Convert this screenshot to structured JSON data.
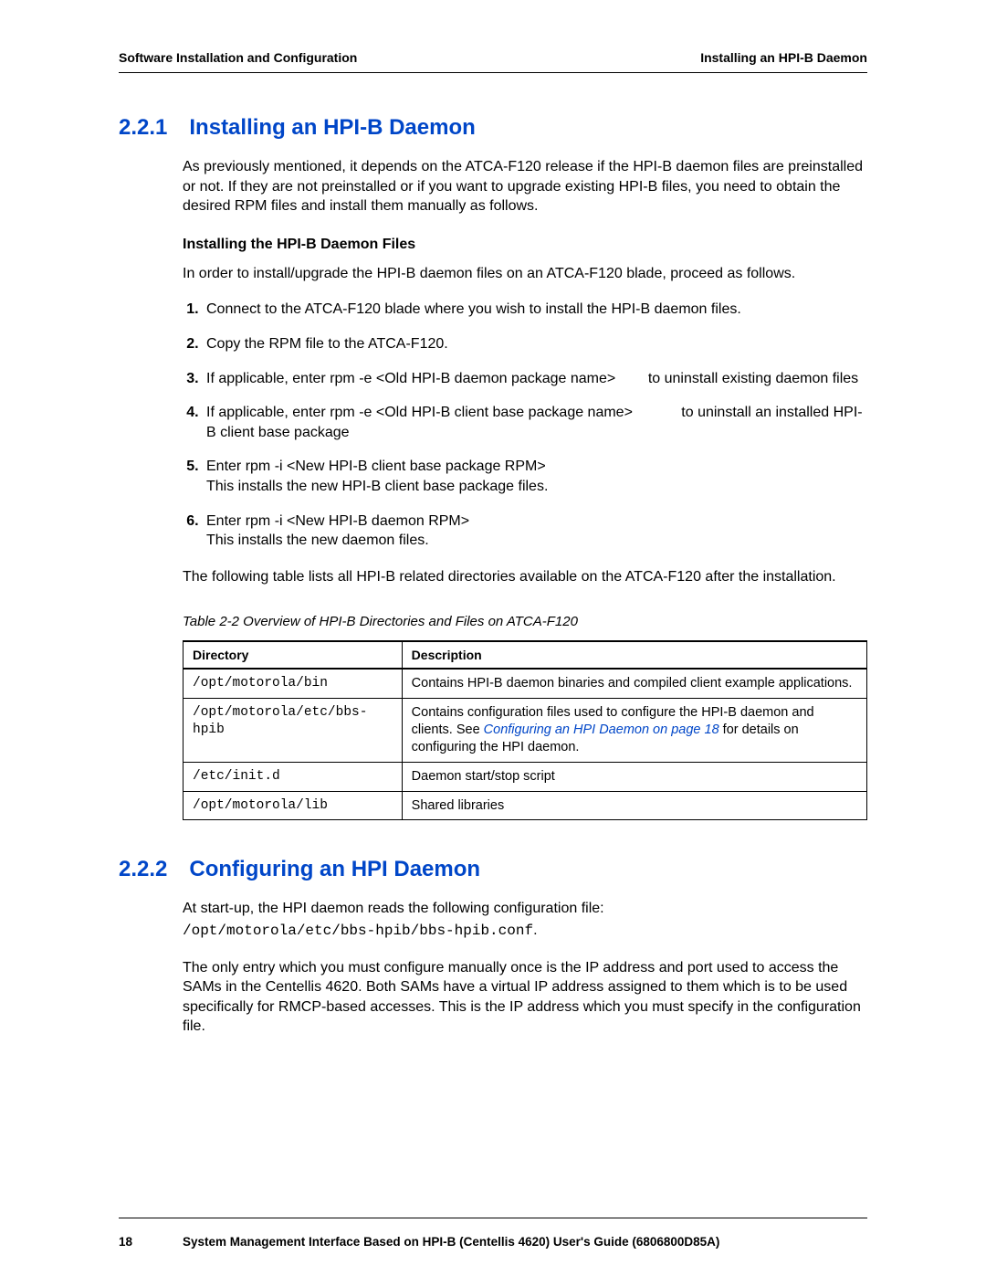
{
  "header": {
    "left": "Software Installation and Configuration",
    "right": "Installing an HPI-B Daemon"
  },
  "section221": {
    "number": "2.2.1",
    "title": "Installing an HPI-B Daemon",
    "intro": "As previously mentioned, it depends on the ATCA-F120 release if the HPI-B daemon files are preinstalled or not. If they are not preinstalled or if you want to upgrade existing HPI-B files, you need to obtain the desired RPM files and install them manually as follows.",
    "subheading": "Installing the HPI-B Daemon Files",
    "subintro": "In order to install/upgrade the HPI-B daemon files on an ATCA-F120 blade, proceed as follows.",
    "steps": {
      "s1": "Connect to the ATCA-F120 blade where you wish to install the HPI-B daemon files.",
      "s2": "Copy the RPM file to the ATCA-F120.",
      "s3a": "If applicable, enter ",
      "s3cmd": "rpm -e <Old HPI-B daemon package name>",
      "s3b": " to uninstall existing daemon files",
      "s4a": "If applicable, enter ",
      "s4cmd": "rpm -e <Old HPI-B client base package name>",
      "s4b": " to uninstall an installed HPI-B client base package",
      "s5a": "Enter ",
      "s5cmd": "rpm -i <New HPI-B client base package RPM>",
      "s5b": "This installs the new HPI-B client base package files.",
      "s6a": "Enter ",
      "s6cmd": "rpm -i <New HPI-B daemon RPM>",
      "s6b": "This installs the new daemon files."
    },
    "afterSteps": "The following table lists all HPI-B related directories available on the ATCA-F120 after the installation.",
    "tableCaption": "Table 2-2 Overview of HPI-B Directories and Files on ATCA-F120",
    "table": {
      "h1": "Directory",
      "h2": "Description",
      "rows": {
        "r0": {
          "dir": "/opt/motorola/bin",
          "desc": "Contains HPI-B daemon binaries and compiled client example applications."
        },
        "r1": {
          "dir": "/opt/motorola/etc/bbs-hpib",
          "desc_pre": "Contains configuration files used to configure the HPI-B daemon and clients. See ",
          "desc_link1": "Configuring an HPI Daemon",
          "desc_mid": " on ",
          "desc_link2": "page 18",
          "desc_post": " for details on configuring the HPI daemon."
        },
        "r2": {
          "dir": "/etc/init.d",
          "desc": "Daemon start/stop script"
        },
        "r3": {
          "dir": "/opt/motorola/lib",
          "desc": "Shared libraries"
        }
      }
    }
  },
  "section222": {
    "number": "2.2.2",
    "title": "Configuring an HPI Daemon",
    "p1": "At start-up, the HPI daemon reads the following configuration file:",
    "confpath": "/opt/motorola/etc/bbs-hpib/bbs-hpib.conf",
    "period": ".",
    "p2": "The only entry which you must configure manually once is the IP address and port used to access the SAMs in the Centellis 4620. Both SAMs have a virtual IP address assigned to them which is to be used specifically for RMCP-based accesses. This is the IP address which you must specify in the configuration file."
  },
  "footer": {
    "page": "18",
    "text": "System Management Interface Based on HPI-B (Centellis 4620) User's Guide (6806800D85A)"
  }
}
